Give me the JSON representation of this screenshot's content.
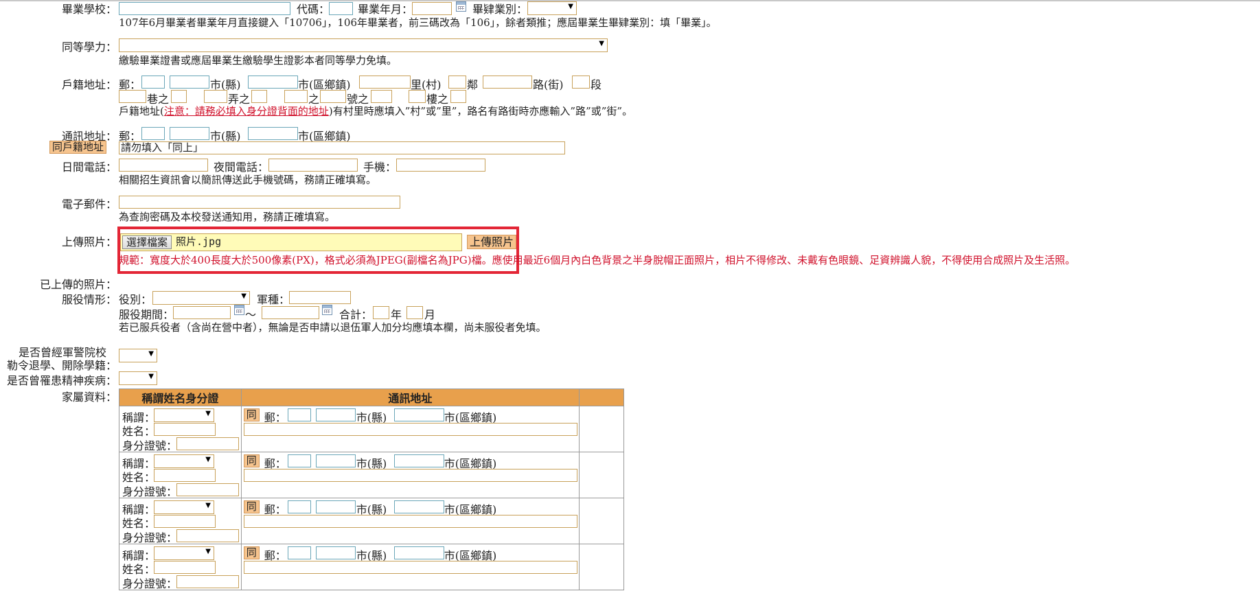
{
  "graduation": {
    "school_label": "畢業學校：",
    "code_label": "代碼：",
    "year_month_label": "畢業年月：",
    "type_label": "畢肄業別：",
    "type_value": "",
    "note": "107年6月畢業者畢業年月直接鍵入「10706」，106年畢業者，前三碼改為「106」，餘者類推；應屆畢業生畢肄業別：填「畢業」。"
  },
  "equivalent": {
    "label": "同等學力：",
    "value": "",
    "note": "繳驗畢業證書或應屆畢業生繳驗學生證影本者同等學力免填。"
  },
  "household": {
    "label": "戶籍地址：",
    "zip": "郵：",
    "city": "市(縣)",
    "district": "市(區鄉鎮)",
    "village": "里(村)",
    "neighbor": "鄰",
    "road": "路(街)",
    "section": "段",
    "lane": "巷之",
    "alley": "弄之",
    "of": "之",
    "number": "號之",
    "floor": "樓之",
    "note_prefix": "戶籍地址(",
    "note_red": "注意：請務必填入身分證背面的地址",
    "note_suffix": ")有村里時應填入”村”或”里”，路名有路街時亦應輸入”路”或”街”。"
  },
  "mailing": {
    "label": "通訊地址：",
    "zip": "郵：",
    "city": "市(縣)",
    "district": "市(區鄉鎮)",
    "same_button": "同戶籍地址",
    "address_value": "請勿填入「同上」"
  },
  "phone": {
    "day_label": "日間電話：",
    "night_label": "夜間電話：",
    "mobile_label": "手機：",
    "note": "相關招生資訊會以簡訊傳送此手機號碼，務請正確填寫。"
  },
  "email": {
    "label": "電子郵件：",
    "note": "為查詢密碼及本校發送通知用，務請正確填寫。"
  },
  "photo": {
    "label": "上傳照片：",
    "choose_button": "選擇檔案",
    "file_name": "照片.jpg",
    "upload_button": "上傳照片",
    "rule": "規範：寬度大於400長度大於500像素(PX)，格式必須為JPEG(副檔名為JPG)檔。應使用最近6個月內白色背景之半身脫帽正面照片，相片不得修改、未戴有色眼鏡、足資辨識人貌，不得使用合成照片及生活照。",
    "uploaded_label": "已上傳的照片："
  },
  "military": {
    "label": "服役情形：",
    "category_label": "役別：",
    "branch_label": "軍種：",
    "period_label": "服役期間：",
    "tilde": "～",
    "total_label": "合計：",
    "year": "年",
    "month": "月",
    "note": "若已服兵役者（含尚在營中者），無論是否申請以退伍軍人加分均應填本欄，尚未服役者免填。"
  },
  "expelled": {
    "label_line1": "是否曾經軍警院校",
    "label_line2": "勒令退學、開除學籍："
  },
  "mental": {
    "label": "是否曾罹患精神疾病："
  },
  "family": {
    "label": "家屬資料：",
    "headers": [
      "稱謂姓名身分證",
      "通訊地址",
      ""
    ],
    "title_label": "稱謂：",
    "name_label": "姓名：",
    "id_label": "身分證號：",
    "same_button": "同",
    "zip": "郵：",
    "city": "市(縣)",
    "district": "市(區鄉鎮)"
  },
  "colors": {
    "highlight_box": "#e32636",
    "table_header": "#e8a04c",
    "button_orange": "#f6c48e",
    "warning_red": "#d0112b"
  }
}
